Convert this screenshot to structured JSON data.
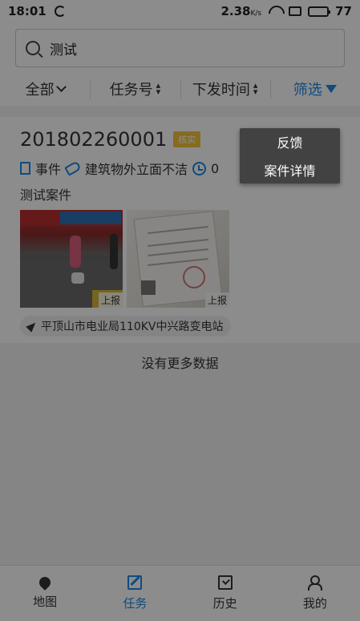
{
  "status_bar": {
    "time": "18:01",
    "speed": "2.38",
    "speed_unit": "K/s",
    "battery": "77"
  },
  "search": {
    "value": "测试",
    "placeholder": ""
  },
  "filters": {
    "all": "全部",
    "task_no": "任务号",
    "issue_time": "下发时间",
    "filter": "筛选"
  },
  "card": {
    "case_no": "201802260001",
    "badge": "核实",
    "type": "事件",
    "category": "建筑物外立面不洁",
    "time_prefix": "0",
    "description": "测试案件",
    "photo_label_1": "上报",
    "photo_label_2": "上报",
    "location": "平顶山市电业局110KV中兴路变电站"
  },
  "list_footer": "没有更多数据",
  "tabs": {
    "map": "地图",
    "task": "任务",
    "history": "历史",
    "mine": "我的"
  },
  "popup_menu": {
    "feedback": "反馈",
    "case_detail": "案件详情"
  },
  "colors": {
    "accent": "#1e88e5",
    "badge": "#f5c33b",
    "overlay": "rgba(0,0,0,0.45)",
    "menu_bg": "#424242"
  }
}
